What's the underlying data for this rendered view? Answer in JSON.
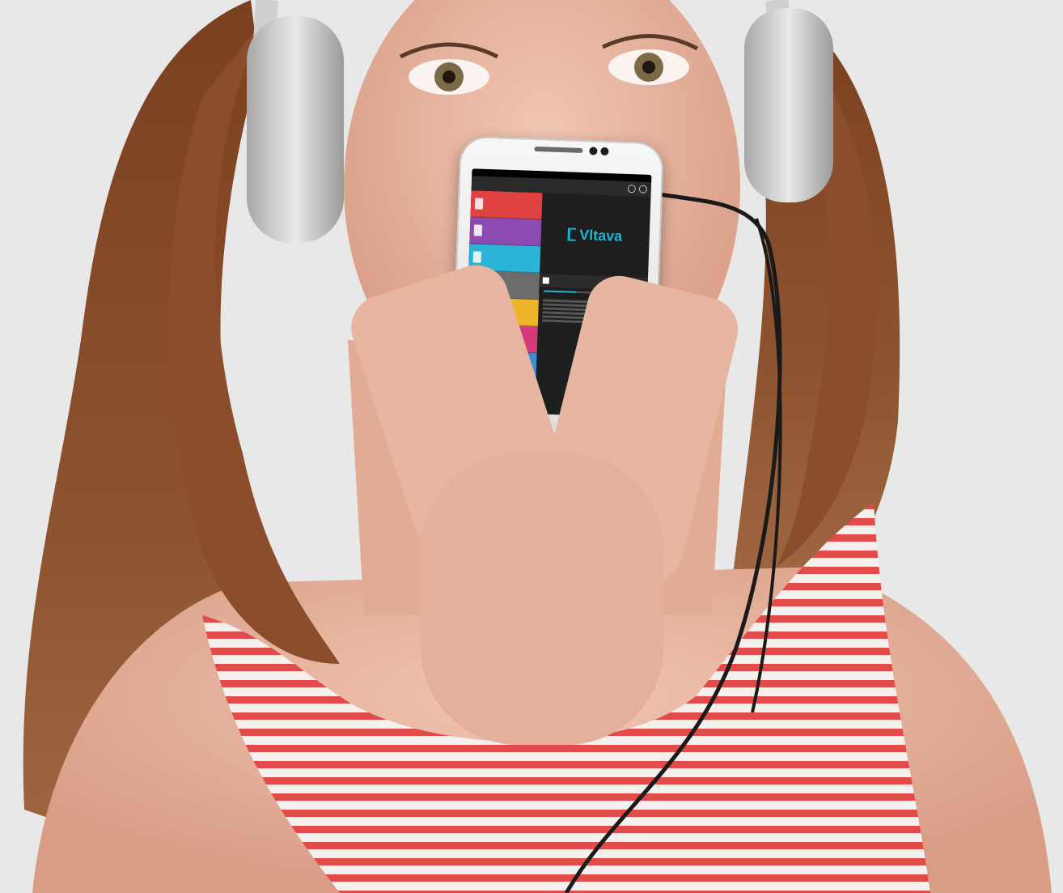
{
  "brand": {
    "name": "Vltava"
  }
}
